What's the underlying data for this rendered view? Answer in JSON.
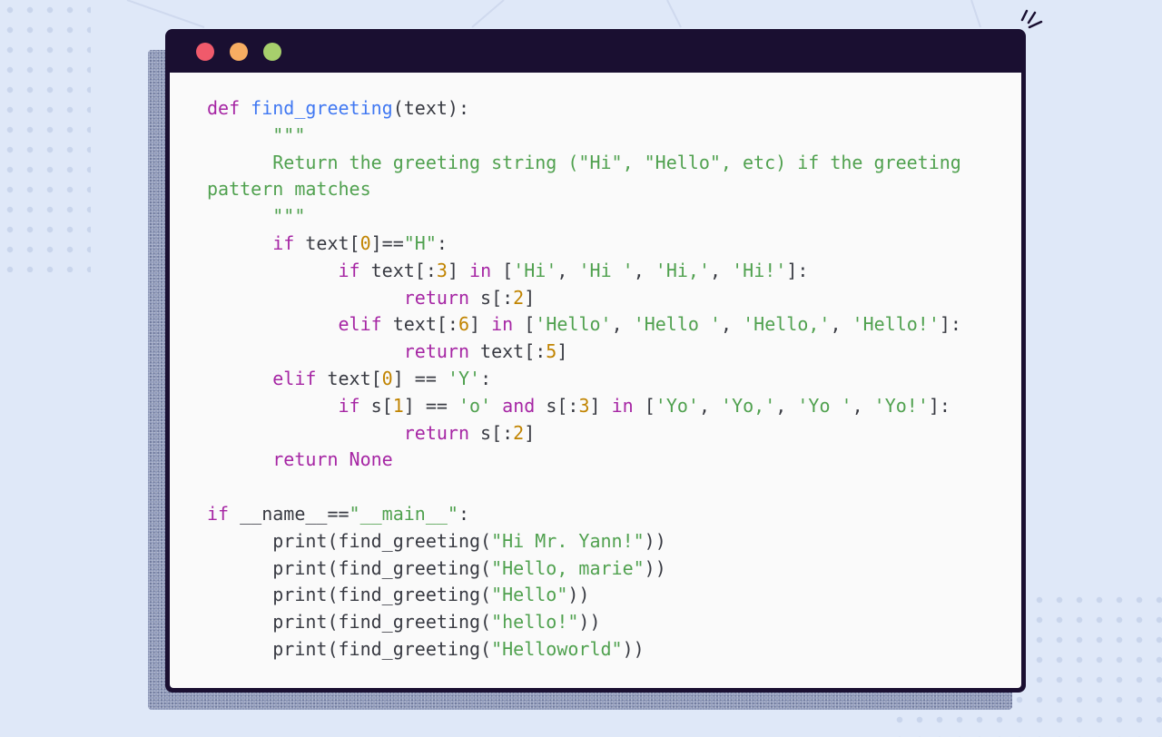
{
  "window": {
    "controls": [
      {
        "name": "close",
        "color": "#f05a6b"
      },
      {
        "name": "minimize",
        "color": "#f7ad62"
      },
      {
        "name": "maximize",
        "color": "#a7cf6c"
      }
    ]
  },
  "code": {
    "language": "python",
    "lines": [
      [
        {
          "t": "kw",
          "v": "def"
        },
        {
          "t": "p",
          "v": " "
        },
        {
          "t": "fn",
          "v": "find_greeting"
        },
        {
          "t": "p",
          "v": "(text):"
        }
      ],
      [
        {
          "t": "p",
          "v": "      "
        },
        {
          "t": "st",
          "v": "\"\"\""
        }
      ],
      [
        {
          "t": "p",
          "v": "      "
        },
        {
          "t": "st",
          "v": "Return the greeting string (\"Hi\", \"Hello\", etc) if the greeting"
        }
      ],
      [
        {
          "t": "st",
          "v": "pattern matches"
        }
      ],
      [
        {
          "t": "p",
          "v": "      "
        },
        {
          "t": "st",
          "v": "\"\"\""
        }
      ],
      [
        {
          "t": "p",
          "v": "      "
        },
        {
          "t": "kw",
          "v": "if"
        },
        {
          "t": "p",
          "v": " text["
        },
        {
          "t": "nu",
          "v": "0"
        },
        {
          "t": "p",
          "v": "]=="
        },
        {
          "t": "st",
          "v": "\"H\""
        },
        {
          "t": "p",
          "v": ":"
        }
      ],
      [
        {
          "t": "p",
          "v": "            "
        },
        {
          "t": "kw",
          "v": "if"
        },
        {
          "t": "p",
          "v": " text[:"
        },
        {
          "t": "nu",
          "v": "3"
        },
        {
          "t": "p",
          "v": "] "
        },
        {
          "t": "kw",
          "v": "in"
        },
        {
          "t": "p",
          "v": " ["
        },
        {
          "t": "st",
          "v": "'Hi'"
        },
        {
          "t": "p",
          "v": ", "
        },
        {
          "t": "st",
          "v": "'Hi '"
        },
        {
          "t": "p",
          "v": ", "
        },
        {
          "t": "st",
          "v": "'Hi,'"
        },
        {
          "t": "p",
          "v": ", "
        },
        {
          "t": "st",
          "v": "'Hi!'"
        },
        {
          "t": "p",
          "v": "]:"
        }
      ],
      [
        {
          "t": "p",
          "v": "                  "
        },
        {
          "t": "kw",
          "v": "return"
        },
        {
          "t": "p",
          "v": " s[:"
        },
        {
          "t": "nu",
          "v": "2"
        },
        {
          "t": "p",
          "v": "]"
        }
      ],
      [
        {
          "t": "p",
          "v": "            "
        },
        {
          "t": "kw",
          "v": "elif"
        },
        {
          "t": "p",
          "v": " text[:"
        },
        {
          "t": "nu",
          "v": "6"
        },
        {
          "t": "p",
          "v": "] "
        },
        {
          "t": "kw",
          "v": "in"
        },
        {
          "t": "p",
          "v": " ["
        },
        {
          "t": "st",
          "v": "'Hello'"
        },
        {
          "t": "p",
          "v": ", "
        },
        {
          "t": "st",
          "v": "'Hello '"
        },
        {
          "t": "p",
          "v": ", "
        },
        {
          "t": "st",
          "v": "'Hello,'"
        },
        {
          "t": "p",
          "v": ", "
        },
        {
          "t": "st",
          "v": "'Hello!'"
        },
        {
          "t": "p",
          "v": "]:"
        }
      ],
      [
        {
          "t": "p",
          "v": "                  "
        },
        {
          "t": "kw",
          "v": "return"
        },
        {
          "t": "p",
          "v": " text[:"
        },
        {
          "t": "nu",
          "v": "5"
        },
        {
          "t": "p",
          "v": "]"
        }
      ],
      [
        {
          "t": "p",
          "v": "      "
        },
        {
          "t": "kw",
          "v": "elif"
        },
        {
          "t": "p",
          "v": " text["
        },
        {
          "t": "nu",
          "v": "0"
        },
        {
          "t": "p",
          "v": "] == "
        },
        {
          "t": "st",
          "v": "'Y'"
        },
        {
          "t": "p",
          "v": ":"
        }
      ],
      [
        {
          "t": "p",
          "v": "            "
        },
        {
          "t": "kw",
          "v": "if"
        },
        {
          "t": "p",
          "v": " s["
        },
        {
          "t": "nu",
          "v": "1"
        },
        {
          "t": "p",
          "v": "] == "
        },
        {
          "t": "st",
          "v": "'o'"
        },
        {
          "t": "p",
          "v": " "
        },
        {
          "t": "kw",
          "v": "and"
        },
        {
          "t": "p",
          "v": " s[:"
        },
        {
          "t": "nu",
          "v": "3"
        },
        {
          "t": "p",
          "v": "] "
        },
        {
          "t": "kw",
          "v": "in"
        },
        {
          "t": "p",
          "v": " ["
        },
        {
          "t": "st",
          "v": "'Yo'"
        },
        {
          "t": "p",
          "v": ", "
        },
        {
          "t": "st",
          "v": "'Yo,'"
        },
        {
          "t": "p",
          "v": ", "
        },
        {
          "t": "st",
          "v": "'Yo '"
        },
        {
          "t": "p",
          "v": ", "
        },
        {
          "t": "st",
          "v": "'Yo!'"
        },
        {
          "t": "p",
          "v": "]:"
        }
      ],
      [
        {
          "t": "p",
          "v": "                  "
        },
        {
          "t": "kw",
          "v": "return"
        },
        {
          "t": "p",
          "v": " s[:"
        },
        {
          "t": "nu",
          "v": "2"
        },
        {
          "t": "p",
          "v": "]"
        }
      ],
      [
        {
          "t": "p",
          "v": "      "
        },
        {
          "t": "kw",
          "v": "return"
        },
        {
          "t": "p",
          "v": " "
        },
        {
          "t": "kw",
          "v": "None"
        }
      ],
      [],
      [
        {
          "t": "kw",
          "v": "if"
        },
        {
          "t": "p",
          "v": " __name__=="
        },
        {
          "t": "st",
          "v": "\"__main__\""
        },
        {
          "t": "p",
          "v": ":"
        }
      ],
      [
        {
          "t": "p",
          "v": "      print(find_greeting("
        },
        {
          "t": "st",
          "v": "\"Hi Mr. Yann!\""
        },
        {
          "t": "p",
          "v": "))"
        }
      ],
      [
        {
          "t": "p",
          "v": "      print(find_greeting("
        },
        {
          "t": "st",
          "v": "\"Hello, marie\""
        },
        {
          "t": "p",
          "v": "))"
        }
      ],
      [
        {
          "t": "p",
          "v": "      print(find_greeting("
        },
        {
          "t": "st",
          "v": "\"Hello\""
        },
        {
          "t": "p",
          "v": "))"
        }
      ],
      [
        {
          "t": "p",
          "v": "      print(find_greeting("
        },
        {
          "t": "st",
          "v": "\"hello!\""
        },
        {
          "t": "p",
          "v": "))"
        }
      ],
      [
        {
          "t": "p",
          "v": "      print(find_greeting("
        },
        {
          "t": "st",
          "v": "\"Helloworld\""
        },
        {
          "t": "p",
          "v": "))"
        }
      ]
    ]
  }
}
